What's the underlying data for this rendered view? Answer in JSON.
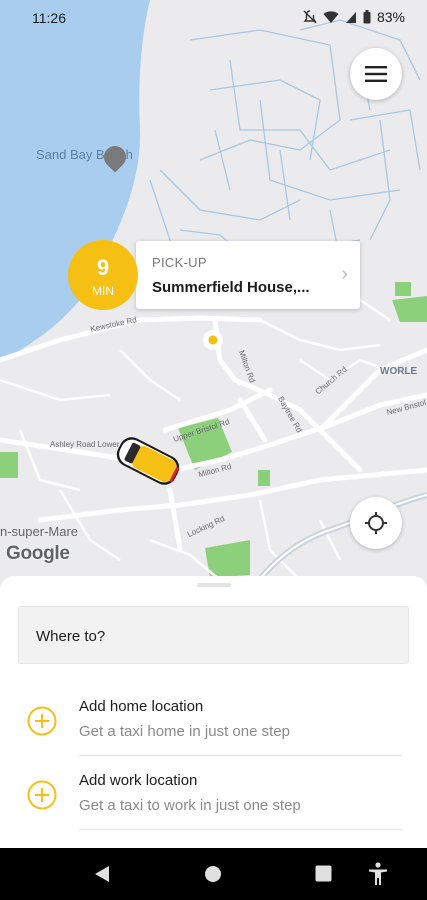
{
  "status_bar": {
    "time": "11:26",
    "battery": "83%",
    "icons": [
      "do-not-disturb-icon",
      "wifi-icon",
      "signal-icon",
      "battery-icon"
    ]
  },
  "map": {
    "place_labels": {
      "sand_bay": "Sand Bay Beach",
      "worle": "WORLE",
      "super_mare": "n-super-Mare"
    },
    "road_labels": {
      "kewstoke": "Kewstoke Rd",
      "milton": "Milton Rd",
      "upper_bristol": "Upper Bristol Rd",
      "church": "Church Rd",
      "baytree": "Baytree Rd",
      "new_bristol": "New Bristol",
      "locking": "Locking Rd",
      "milton2": "Milton Rd",
      "ashley": "Ashley Road Lower"
    },
    "attribution": "Google",
    "colors": {
      "water": "#a9cdef",
      "land": "#ebebee",
      "park": "#8cd07b",
      "road": "#ffffff",
      "minor_road": "#a8c8e4"
    }
  },
  "pickup": {
    "eta_value": "9",
    "eta_unit": "MIN",
    "label": "PICK-UP",
    "address": "Summerfield House,...",
    "accent": "#f5c013"
  },
  "buttons": {
    "menu_icon": "hamburger-menu-icon",
    "locate_icon": "my-location-icon"
  },
  "sheet": {
    "search_placeholder": "Where to?",
    "items": [
      {
        "title": "Add home location",
        "subtitle": "Get a taxi home in just one step"
      },
      {
        "title": "Add work location",
        "subtitle": "Get a taxi to work in just one step"
      }
    ]
  },
  "navbar": {
    "icons": [
      "back-icon",
      "home-icon",
      "recents-icon",
      "accessibility-icon"
    ]
  }
}
